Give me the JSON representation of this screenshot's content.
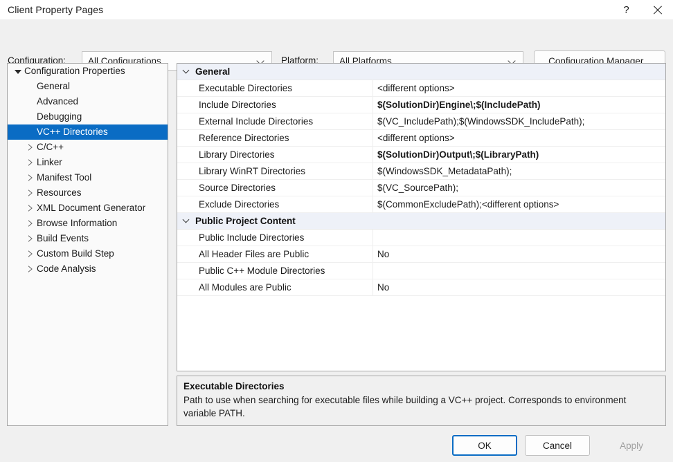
{
  "window": {
    "title": "Client Property Pages",
    "help_glyph": "?",
    "close_glyph": "✕"
  },
  "toolbar": {
    "configuration_label": "Configuration:",
    "configuration_value": "All Configurations",
    "platform_label": "Platform:",
    "platform_value": "All Platforms",
    "configuration_manager_label": "Configuration Manager..."
  },
  "tree": {
    "nodes": [
      {
        "label": "Configuration Properties",
        "level": 0,
        "state": "expanded",
        "selected": false
      },
      {
        "label": "General",
        "level": 1,
        "state": "leaf",
        "selected": false
      },
      {
        "label": "Advanced",
        "level": 1,
        "state": "leaf",
        "selected": false
      },
      {
        "label": "Debugging",
        "level": 1,
        "state": "leaf",
        "selected": false
      },
      {
        "label": "VC++ Directories",
        "level": 1,
        "state": "leaf",
        "selected": true
      },
      {
        "label": "C/C++",
        "level": 1,
        "state": "collapsed",
        "selected": false
      },
      {
        "label": "Linker",
        "level": 1,
        "state": "collapsed",
        "selected": false
      },
      {
        "label": "Manifest Tool",
        "level": 1,
        "state": "collapsed",
        "selected": false
      },
      {
        "label": "Resources",
        "level": 1,
        "state": "collapsed",
        "selected": false
      },
      {
        "label": "XML Document Generator",
        "level": 1,
        "state": "collapsed",
        "selected": false
      },
      {
        "label": "Browse Information",
        "level": 1,
        "state": "collapsed",
        "selected": false
      },
      {
        "label": "Build Events",
        "level": 1,
        "state": "collapsed",
        "selected": false
      },
      {
        "label": "Custom Build Step",
        "level": 1,
        "state": "collapsed",
        "selected": false
      },
      {
        "label": "Code Analysis",
        "level": 1,
        "state": "collapsed",
        "selected": false
      }
    ]
  },
  "propgrid": {
    "groups": [
      {
        "category": "General",
        "expanded": true,
        "rows": [
          {
            "name": "Executable Directories",
            "value": "<different options>",
            "bold": false
          },
          {
            "name": "Include Directories",
            "value": "$(SolutionDir)Engine\\;$(IncludePath)",
            "bold": true
          },
          {
            "name": "External Include Directories",
            "value": "$(VC_IncludePath);$(WindowsSDK_IncludePath);",
            "bold": false
          },
          {
            "name": "Reference Directories",
            "value": "<different options>",
            "bold": false
          },
          {
            "name": "Library Directories",
            "value": "$(SolutionDir)Output\\;$(LibraryPath)",
            "bold": true
          },
          {
            "name": "Library WinRT Directories",
            "value": "$(WindowsSDK_MetadataPath);",
            "bold": false
          },
          {
            "name": "Source Directories",
            "value": "$(VC_SourcePath);",
            "bold": false
          },
          {
            "name": "Exclude Directories",
            "value": "$(CommonExcludePath);<different options>",
            "bold": false
          }
        ]
      },
      {
        "category": "Public Project Content",
        "expanded": true,
        "rows": [
          {
            "name": "Public Include Directories",
            "value": "",
            "bold": false
          },
          {
            "name": "All Header Files are Public",
            "value": "No",
            "bold": false
          },
          {
            "name": "Public C++ Module Directories",
            "value": "",
            "bold": false
          },
          {
            "name": "All Modules are Public",
            "value": "No",
            "bold": false
          }
        ]
      }
    ]
  },
  "description": {
    "title": "Executable Directories",
    "body": "Path to use when searching for executable files while building a VC++ project.  Corresponds to environment variable PATH."
  },
  "footer": {
    "ok_label": "OK",
    "cancel_label": "Cancel",
    "apply_label": "Apply",
    "apply_enabled": false
  },
  "colors": {
    "selection_blue": "#0a6cc4",
    "category_header_bg": "#eef1f8",
    "dialog_bg": "#f0f0f0",
    "border": "#a6a6a6"
  }
}
